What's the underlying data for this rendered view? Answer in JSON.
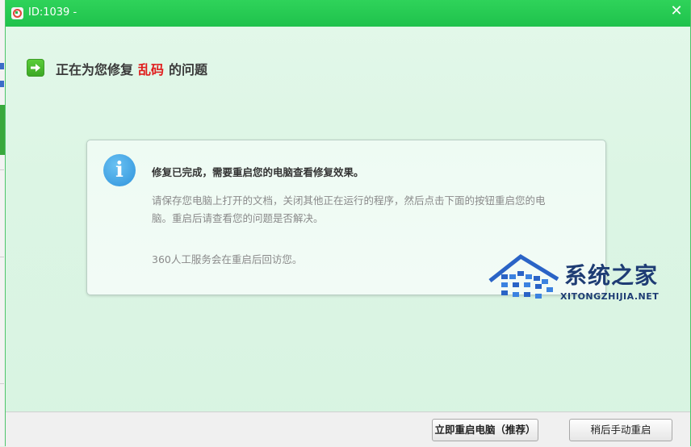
{
  "window": {
    "title": "ID:1039 -",
    "close_symbol": "✕"
  },
  "heading": {
    "prefix": "正在为您修复",
    "highlight": "乱码",
    "suffix": "的问题",
    "icon": "arrow-right-icon",
    "highlight_color": "#e01c1c"
  },
  "message": {
    "icon": "info-icon",
    "icon_glyph": "i",
    "title": "修复已完成，需要重启您的电脑查看修复效果。",
    "body": "请保存您电脑上打开的文档，关闭其他正在运行的程序，然后点击下面的按钮重启您的电脑。重启后请查看您的问题是否解决。",
    "note": "360人工服务会在重启后回访您。"
  },
  "watermark": {
    "text": "系统之家",
    "subtext": "XITONGZHIJIA.NET"
  },
  "buttons": {
    "restart_now": "立即重启电脑（推荐）",
    "restart_later": "稍后手动重启"
  },
  "colors": {
    "titlebar": "#1fc24c",
    "accent_green": "#3aa623",
    "info_blue": "#2f93dc"
  }
}
